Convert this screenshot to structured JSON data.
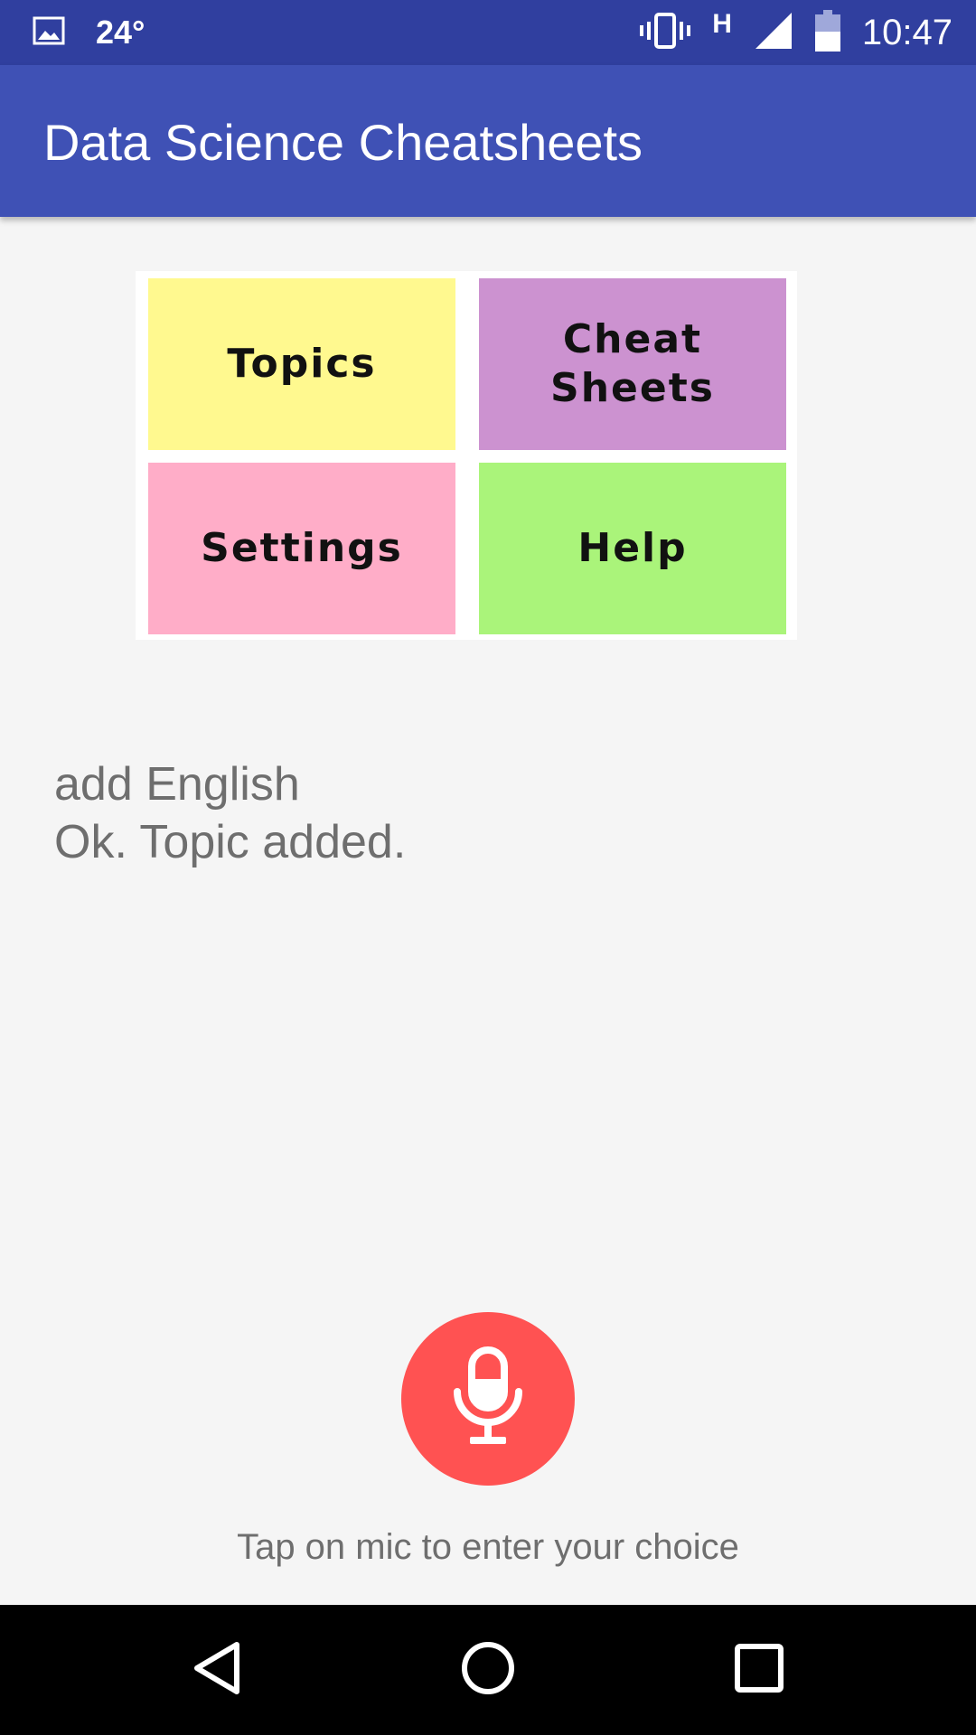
{
  "status_bar": {
    "temperature": "24°",
    "network_type": "H",
    "time": "10:47",
    "icons": [
      "image-notification-icon",
      "vibrate-icon",
      "signal-icon",
      "battery-icon"
    ]
  },
  "app_bar": {
    "title": "Data Science Cheatsheets"
  },
  "menu": {
    "topics": "Topics",
    "cheat_line1": "Cheat",
    "cheat_line2": "Sheets",
    "settings": "Settings",
    "help": "Help",
    "colors": {
      "topics": "#fff98f",
      "cheat_sheets": "#cc92d0",
      "settings": "#ffadc8",
      "help": "#aaf47a"
    }
  },
  "transcript": {
    "command": "add English",
    "response": "Ok. Topic added."
  },
  "mic": {
    "hint": "Tap on mic to enter your choice",
    "color": "#ff5252"
  },
  "nav": {
    "icons": [
      "back-icon",
      "home-icon",
      "recents-icon"
    ]
  },
  "theme": {
    "primary": "#3f51b5",
    "primary_dark": "#303f9f"
  }
}
